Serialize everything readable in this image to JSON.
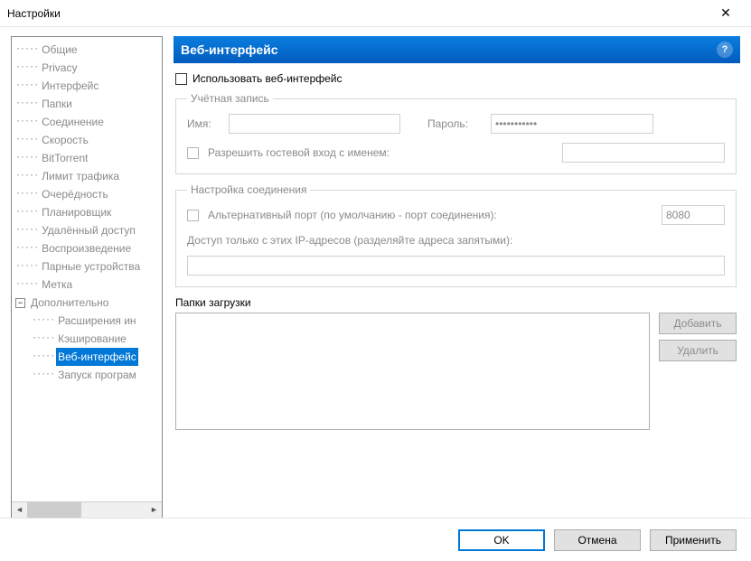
{
  "window": {
    "title": "Настройки"
  },
  "tree": {
    "items": [
      {
        "label": "Общие",
        "kind": "root"
      },
      {
        "label": "Privacy",
        "kind": "root"
      },
      {
        "label": "Интерфейс",
        "kind": "root"
      },
      {
        "label": "Папки",
        "kind": "root"
      },
      {
        "label": "Соединение",
        "kind": "root"
      },
      {
        "label": "Скорость",
        "kind": "root"
      },
      {
        "label": "BitTorrent",
        "kind": "root"
      },
      {
        "label": "Лимит трафика",
        "kind": "root"
      },
      {
        "label": "Очерёдность",
        "kind": "root"
      },
      {
        "label": "Планировщик",
        "kind": "root"
      },
      {
        "label": "Удалённый доступ",
        "kind": "root"
      },
      {
        "label": "Воспроизведение",
        "kind": "root"
      },
      {
        "label": "Парные устройства",
        "kind": "root"
      },
      {
        "label": "Метка",
        "kind": "root"
      },
      {
        "label": "Дополнительно",
        "kind": "expand"
      },
      {
        "label": "Расширения ин",
        "kind": "child"
      },
      {
        "label": "Кэширование",
        "kind": "child"
      },
      {
        "label": "Веб-интерфейс",
        "kind": "child",
        "selected": true
      },
      {
        "label": "Запуск програм",
        "kind": "child"
      }
    ]
  },
  "main": {
    "header": "Веб-интерфейс",
    "enable_label": "Использовать веб-интерфейс",
    "account": {
      "legend": "Учётная запись",
      "name_label": "Имя:",
      "name_value": "",
      "pass_label": "Пароль:",
      "pass_value": "•••••••••••",
      "guest_label": "Разрешить гостевой вход с именем:",
      "guest_value": ""
    },
    "conn": {
      "legend": "Настройка соединения",
      "alt_port_label": "Альтернативный порт (по умолчанию - порт соединения):",
      "alt_port_value": "8080",
      "ip_label": "Доступ только с этих IP-адресов (разделяйте адреса запятыми):",
      "ip_value": ""
    },
    "folders": {
      "legend": "Папки загрузки",
      "add": "Добавить",
      "remove": "Удалить"
    }
  },
  "buttons": {
    "ok": "OK",
    "cancel": "Отмена",
    "apply": "Применить"
  }
}
